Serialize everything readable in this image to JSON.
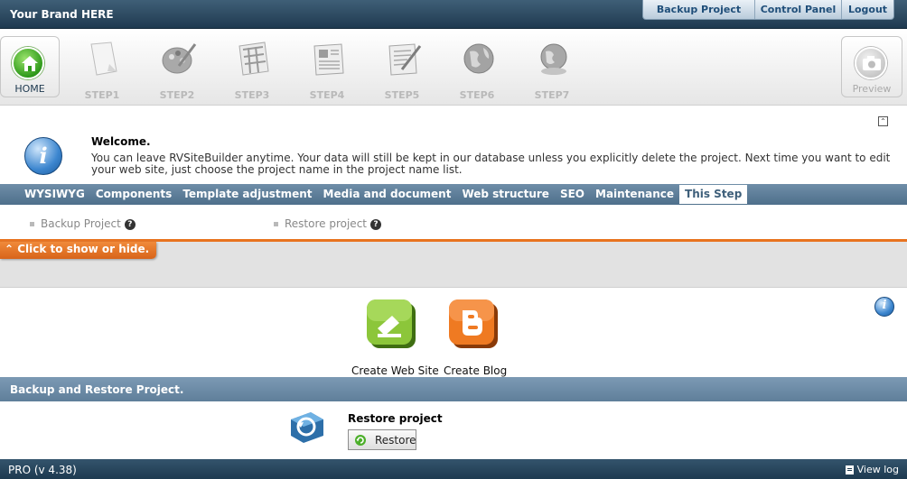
{
  "header": {
    "brand": "Your Brand HERE",
    "links": [
      "Backup Project",
      "Control Panel",
      "Logout"
    ]
  },
  "nav": {
    "home_label": "HOME",
    "steps": [
      "STEP1",
      "STEP2",
      "STEP3",
      "STEP4",
      "STEP5",
      "STEP6",
      "STEP7"
    ],
    "preview_label": "Preview"
  },
  "welcome": {
    "title": "Welcome.",
    "text": "You can leave RVSiteBuilder anytime. Your data will still be kept in our database unless you explicitly delete the project. Next time you want to edit your web site, just choose the project name in the project name list."
  },
  "menu": {
    "items": [
      "WYSIWYG",
      "Components",
      "Template adjustment",
      "Media and document",
      "Web structure",
      "SEO",
      "Maintenance",
      "This Step"
    ],
    "active": "This Step"
  },
  "subopts": [
    "Backup Project",
    "Restore project"
  ],
  "toggle": {
    "label": "Click to show or hide."
  },
  "actions": {
    "create_web_site": "Create Web Site",
    "create_blog": "Create Blog"
  },
  "section": {
    "title": "Backup and Restore Project.",
    "restore_title": "Restore project",
    "restore_button": "Restore"
  },
  "status": {
    "version": "PRO (v 4.38)",
    "view_log": "View log"
  },
  "colors": {
    "header_bg": "#1f3a50",
    "menu_bg": "#5a7a96",
    "accent_orange": "#e8731f",
    "home_green": "#2f9a1a"
  }
}
